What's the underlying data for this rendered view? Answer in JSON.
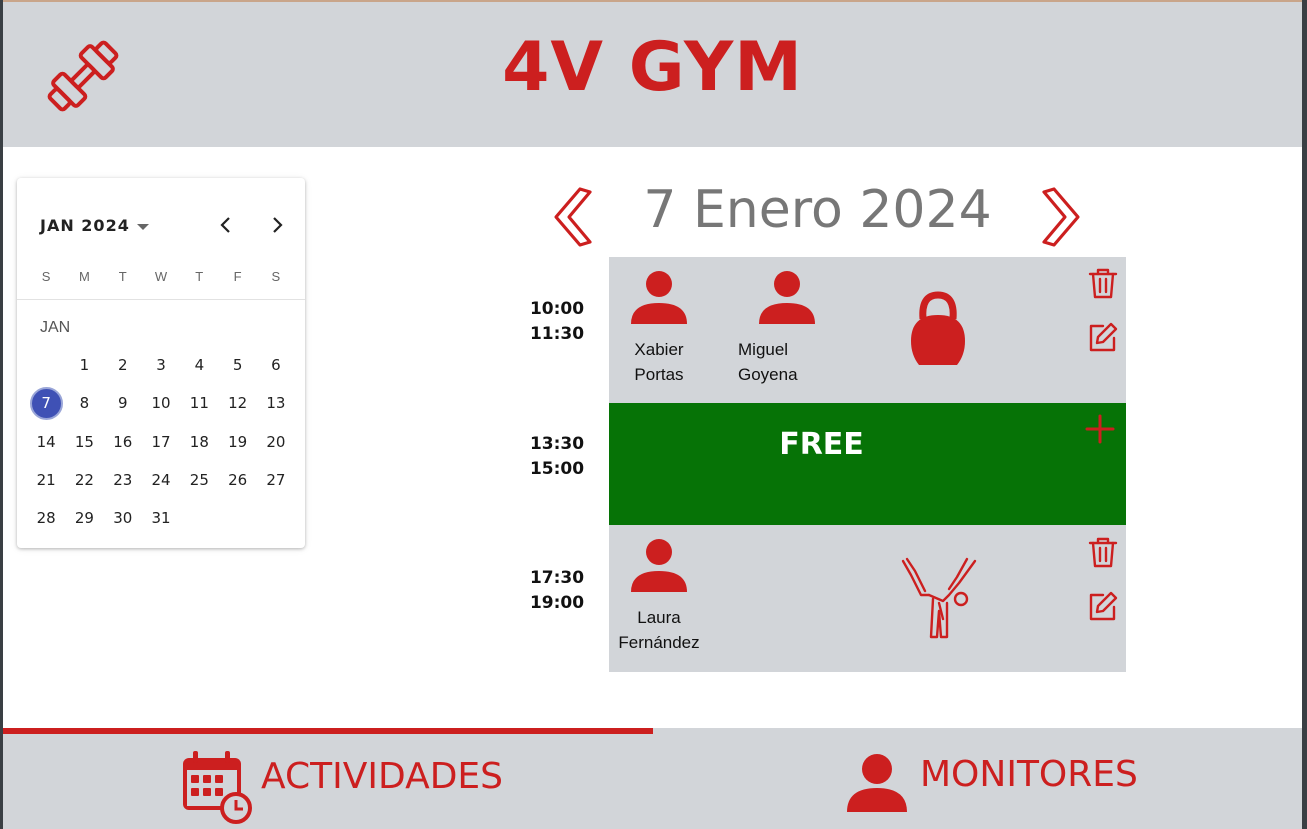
{
  "app": {
    "title": "4V GYM"
  },
  "calendar": {
    "month_label": "JAN 2024",
    "weekday_headers": [
      "S",
      "M",
      "T",
      "W",
      "T",
      "F",
      "S"
    ],
    "section_label": "JAN",
    "days": [
      [
        "",
        "1",
        "2",
        "3",
        "4",
        "5",
        "6"
      ],
      [
        "7",
        "8",
        "9",
        "10",
        "11",
        "12",
        "13"
      ],
      [
        "14",
        "15",
        "16",
        "17",
        "18",
        "19",
        "20"
      ],
      [
        "21",
        "22",
        "23",
        "24",
        "25",
        "26",
        "27"
      ],
      [
        "28",
        "29",
        "30",
        "31",
        "",
        "",
        ""
      ]
    ],
    "selected_day": "7"
  },
  "schedule": {
    "date_title": "7 Enero 2024",
    "slots": [
      {
        "start": "10:00",
        "end": "11:30",
        "status": "booked",
        "monitors": [
          {
            "name_line1": "Xabier",
            "name_line2": "Portas"
          },
          {
            "name_line1": "Miguel",
            "name_line2": "Goyena"
          }
        ],
        "activity_icon": "kettlebell-icon"
      },
      {
        "start": "13:30",
        "end": "15:00",
        "status": "free",
        "label": "FREE"
      },
      {
        "start": "17:30",
        "end": "19:00",
        "status": "booked",
        "monitors": [
          {
            "name_line1": "Laura",
            "name_line2": "Fernández"
          }
        ],
        "activity_icon": "pilates-figure-icon"
      }
    ]
  },
  "footer": {
    "tabs": [
      {
        "label": "ACTIVIDADES",
        "icon": "calendar-clock-icon",
        "active": true
      },
      {
        "label": "MONITORES",
        "icon": "person-icon",
        "active": false
      }
    ]
  },
  "colors": {
    "brand_red": "#cc1f1f",
    "panel_gray": "#d2d5d9",
    "free_green": "#067306",
    "selected_blue": "#3f51b5"
  }
}
